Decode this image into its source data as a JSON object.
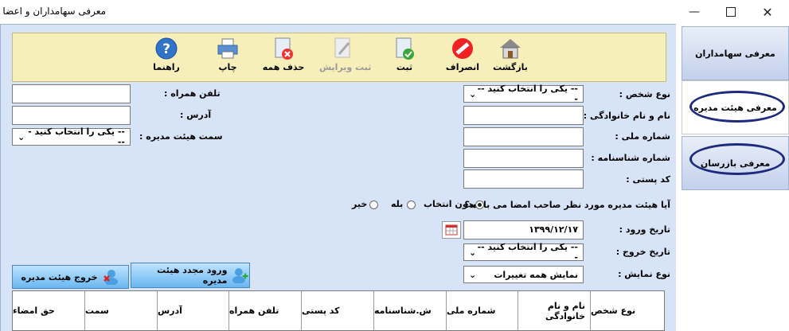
{
  "window": {
    "title": "معرفی سهامداران و اعضا",
    "minimize_icon": "minimize-icon",
    "maximize_icon": "maximize-icon",
    "close_icon": "close-icon"
  },
  "toolbar": {
    "back": "بازگشت",
    "cancel": "انصراف",
    "save": "ثبت",
    "save_edit": "ثبت ویرایش",
    "delete_all": "حذف همه",
    "print": "چاپ",
    "help": "راهنما"
  },
  "form": {
    "person_type_label": "نوع شخص :",
    "person_type_value": "-- یکی را انتخاب کنید ---",
    "full_name_label": "نام و نام خانوادگی :",
    "full_name_value": "",
    "national_id_label": "شماره ملی :",
    "national_id_value": "",
    "id_number_label": "شماره شناسنامه :",
    "id_number_value": "",
    "postal_code_label": "کد پستی :",
    "postal_code_value": "",
    "mobile_label": "تلفن همراه :",
    "mobile_value": "",
    "address_label": "آدرس :",
    "address_value": "",
    "board_position_label": "سمت هیئت مدیره :",
    "board_position_value": "-- یکی را انتخاب کنید ---",
    "signatory_question": "آیا هیئت مدیره مورد نظر صاحب امضا می باشد؟",
    "radio_none": "بدون انتخاب",
    "radio_yes": "بله",
    "radio_no": "خیر",
    "entry_date_label": "تاریخ ورود :",
    "entry_date_value": "۱۳۹۹/۱۲/۱۷",
    "exit_date_label": "تاریخ خروج :",
    "exit_date_value": "-- یکی را انتخاب کنید ---",
    "display_type_label": "نوع نمایش :",
    "display_type_value": "نمایش همه تغییرات"
  },
  "buttons": {
    "reentry": "ورود مجدد هیئت مدیره",
    "exit_board": "خروج هیئت مدیره"
  },
  "grid": {
    "columns": [
      "نوع شخص",
      "نام و نام خانوادگی",
      "شماره ملی",
      "ش.شناسنامه",
      "کد پستی",
      "تلفن همراه",
      "آدرس",
      "سمت",
      "حق امضاء"
    ]
  },
  "nav": {
    "shareholders": "معرفی سهامداران",
    "board": "معرفی هیئت مدیره",
    "inspectors": "معرفی بازرسان"
  },
  "colors": {
    "panel": "#d7e3f7",
    "toolbar": "#f7efb9",
    "highlight_ellipse": "#1d2a7d"
  }
}
